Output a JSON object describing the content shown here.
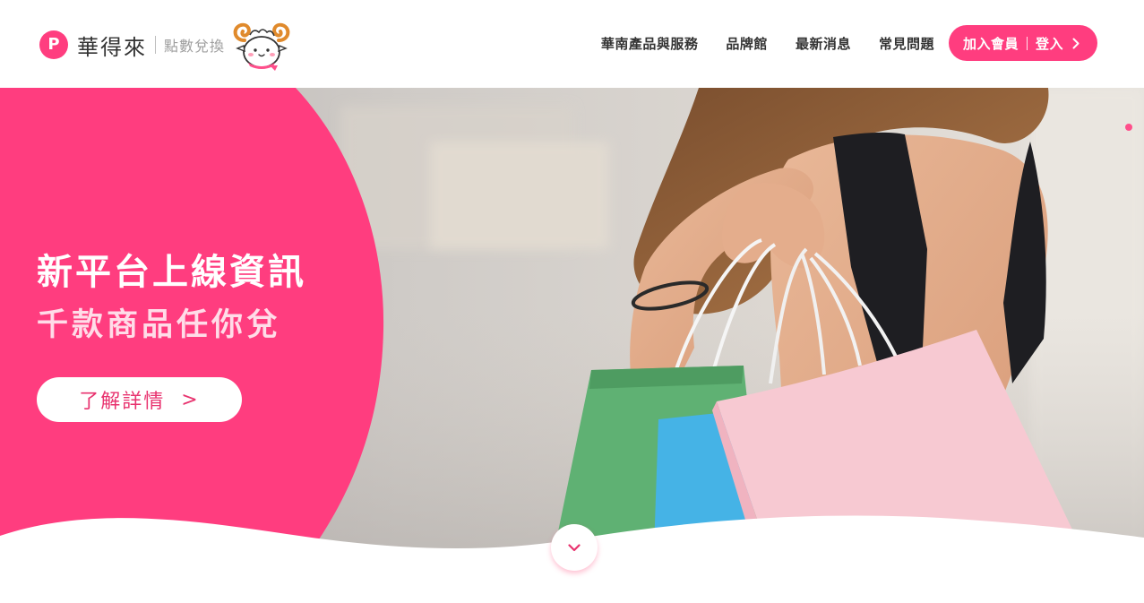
{
  "brand": {
    "logo_letter": "P",
    "name": "華得來",
    "subtitle": "點數兌換",
    "accent_color": "#ff3d7f",
    "mascot_icon": "ram-mascot-icon"
  },
  "nav": {
    "items": [
      {
        "label": "華南產品與服務"
      },
      {
        "label": "品牌館"
      },
      {
        "label": "最新消息"
      },
      {
        "label": "常見問題"
      }
    ],
    "member": {
      "join_label": "加入會員",
      "login_label": "登入",
      "icon": "chevron-right-icon"
    }
  },
  "hero": {
    "title": "新平台上線資訊",
    "subtitle": "千款商品任你兌",
    "cta_label": "了解詳情",
    "cta_arrow": ">",
    "image": "woman-with-shopping-bags-photo",
    "scroll_icon": "chevron-down-icon"
  }
}
